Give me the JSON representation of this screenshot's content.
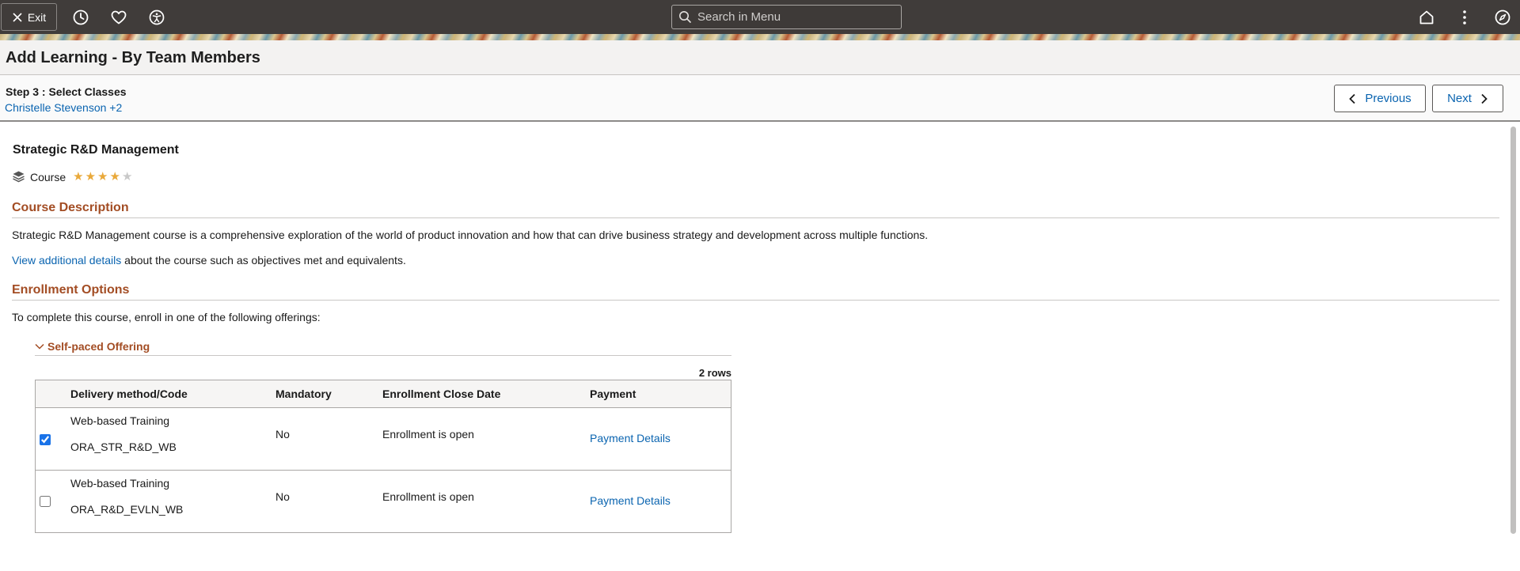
{
  "header": {
    "exit_label": "Exit",
    "icons": [
      "close-icon",
      "history-icon",
      "favorites-icon",
      "accessibility-icon",
      "home-icon",
      "more-options-icon",
      "navigator-icon"
    ],
    "search_placeholder": "Search in Menu",
    "bg_color": "#403c3a"
  },
  "page": {
    "title": "Add Learning - By Team Members"
  },
  "step": {
    "label": "Step 3 :  Select Classes",
    "members": "Christelle Stevenson +2",
    "previous_label": "Previous",
    "next_label": "Next"
  },
  "course": {
    "title": "Strategic R&D Management",
    "type": "Course",
    "rating": 4,
    "rating_max": 5,
    "description_heading": "Course Description",
    "description": "Strategic R&D Management course is a comprehensive exploration of the world of product innovation and how that can drive business strategy and development across multiple functions.",
    "details_link": "View additional details",
    "details_suffix": " about the course such as objectives met and equivalents."
  },
  "enrollment": {
    "heading": "Enrollment Options",
    "instruction": "To complete this course, enroll in one of the following offerings:",
    "offering_title": "Self-paced Offering",
    "rows_count": "2 rows",
    "columns": [
      "Delivery method/Code",
      "Mandatory",
      "Enrollment Close Date",
      "Payment"
    ],
    "rows": [
      {
        "selected": true,
        "method": "Web-based Training",
        "code": "ORA_STR_R&D_WB",
        "mandatory": "No",
        "close_date": "Enrollment is open",
        "payment": "Payment Details"
      },
      {
        "selected": false,
        "method": "Web-based Training",
        "code": "ORA_R&D_EVLN_WB",
        "mandatory": "No",
        "close_date": "Enrollment is open",
        "payment": "Payment Details"
      }
    ]
  },
  "colors": {
    "accent_heading": "#a34d24",
    "link": "#0a64b0",
    "star": "#e9a93a"
  }
}
